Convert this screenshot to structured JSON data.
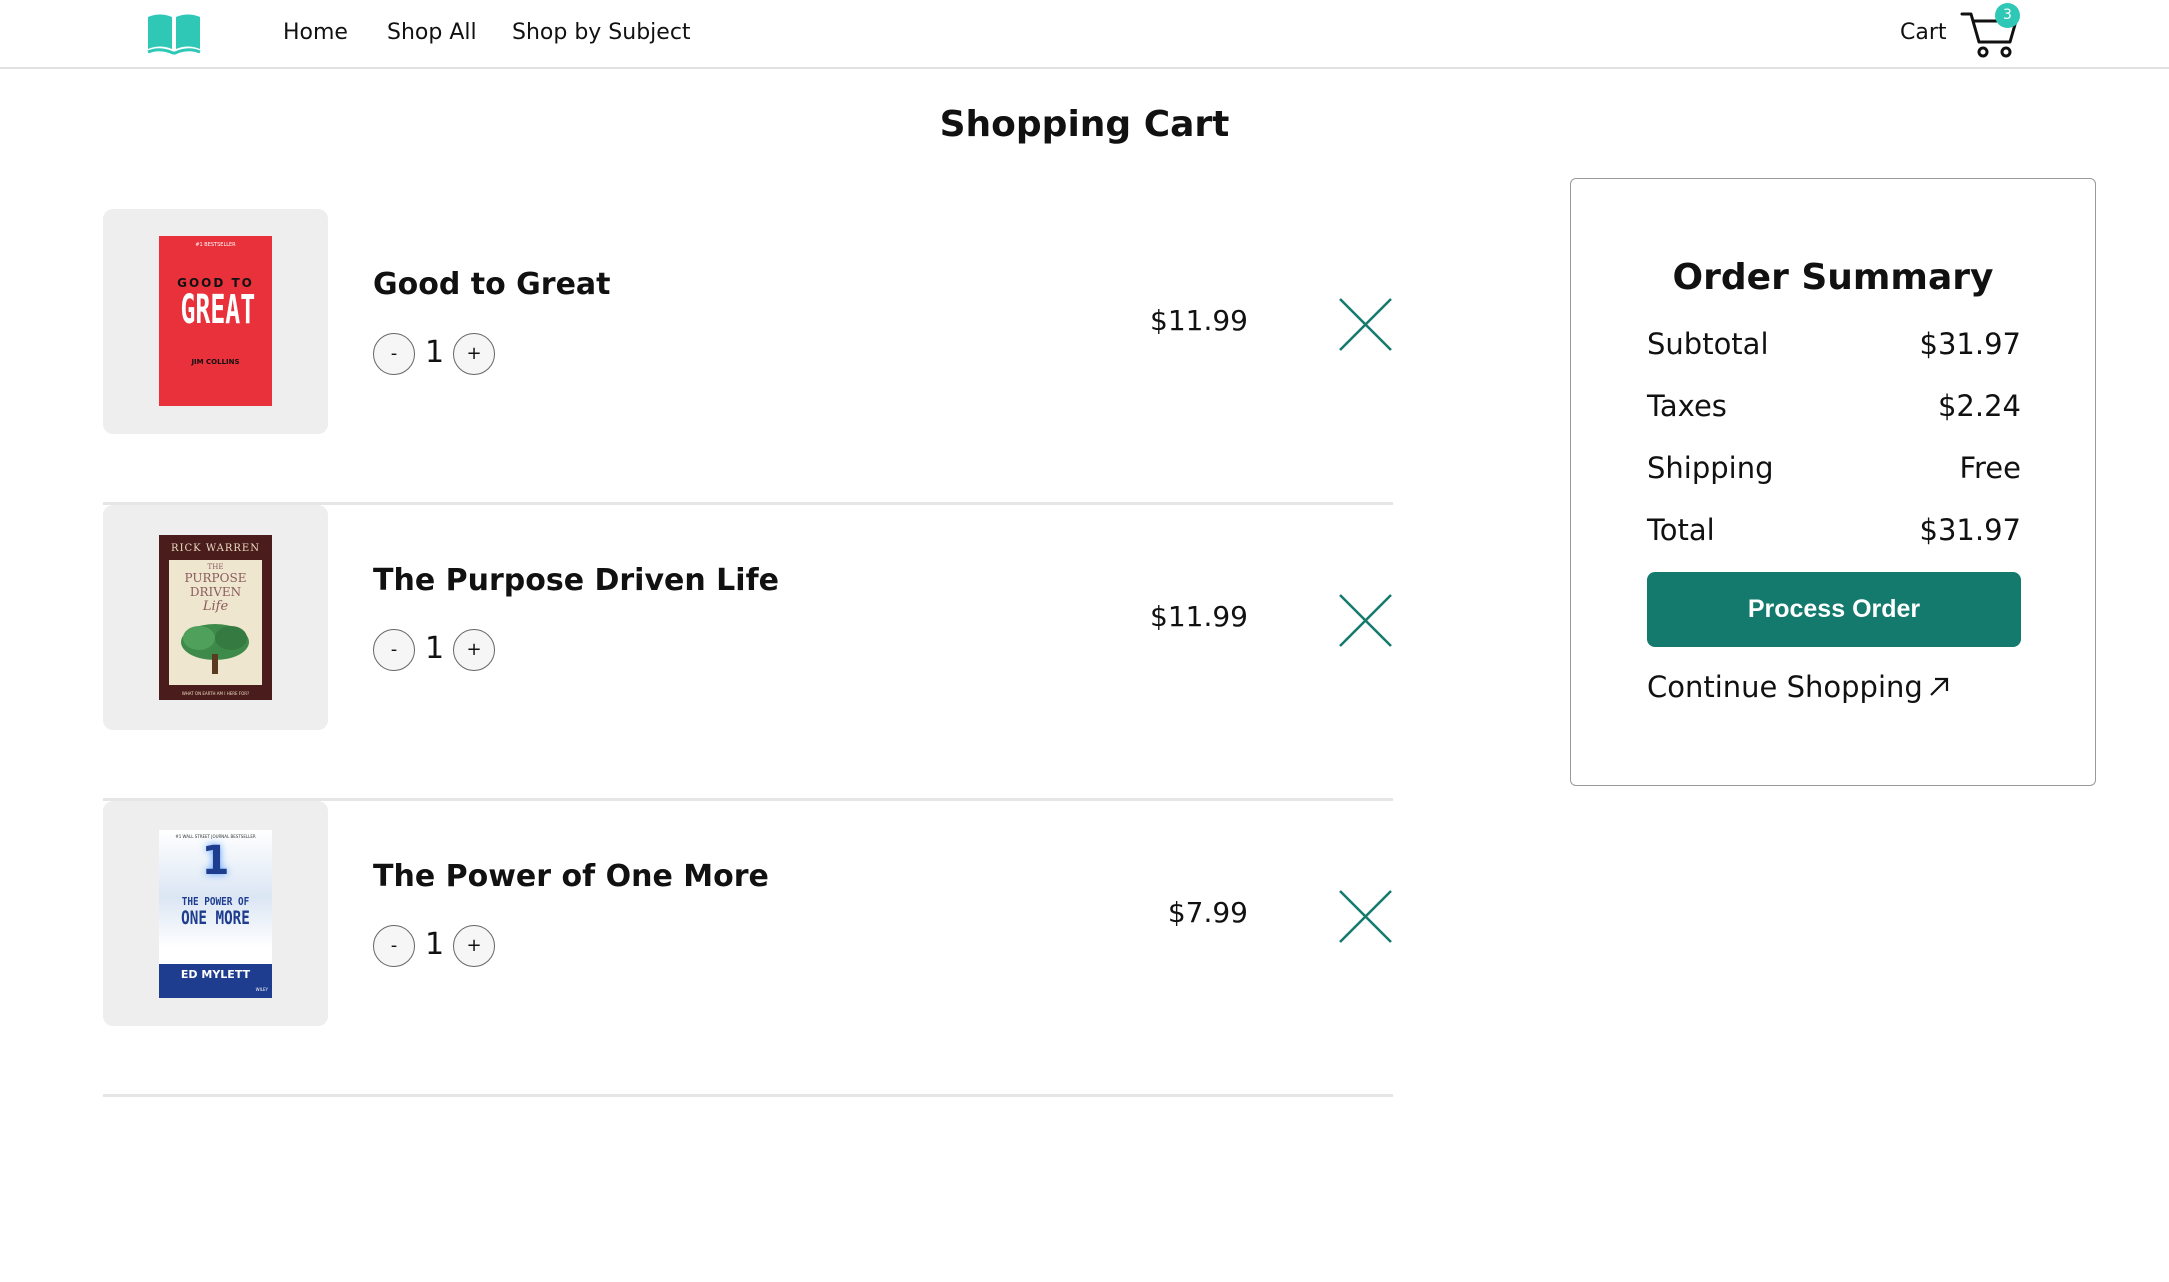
{
  "nav": {
    "links": [
      "Home",
      "Shop All",
      "Shop by Subject"
    ],
    "cart_label": "Cart",
    "cart_count": "3",
    "brand_color": "#2fc7b5"
  },
  "page": {
    "title": "Shopping Cart"
  },
  "cart_items": [
    {
      "title": "Good to Great",
      "qty": "1",
      "price": "$11.99",
      "cover": {
        "top_text": "#1 BESTSELLER",
        "line1": "GOOD TO",
        "line2": "GREAT",
        "author": "JIM COLLINS",
        "color": "#e8313a"
      }
    },
    {
      "title": "The Purpose Driven Life",
      "qty": "1",
      "price": "$11.99",
      "cover": {
        "author": "RICK WARREN",
        "line0": "THE",
        "line1": "PURPOSE",
        "line2": "DRIVEN",
        "line3": "Life",
        "footer": "WHAT ON EARTH AM I HERE FOR?",
        "color": "#4a1c1c"
      }
    },
    {
      "title": "The Power of One More",
      "qty": "1",
      "price": "$7.99",
      "cover": {
        "top_text": "#1 WALL STREET JOURNAL BESTSELLER",
        "num": "1",
        "line1": "THE POWER OF",
        "line2": "ONE MORE",
        "author": "ED MYLETT",
        "publisher": "WILEY",
        "color": "#1e3d8f"
      }
    }
  ],
  "qty_controls": {
    "minus": "-",
    "plus": "+"
  },
  "summary": {
    "title": "Order Summary",
    "rows": [
      {
        "label": "Subtotal",
        "value": "$31.97"
      },
      {
        "label": "Taxes",
        "value": "$2.24"
      },
      {
        "label": "Shipping",
        "value": "Free"
      },
      {
        "label": "Total",
        "value": "$31.97"
      }
    ],
    "process_label": "Process Order",
    "continue_label": "Continue Shopping",
    "button_color": "#137a6d"
  },
  "icons": {
    "logo": "open-book-icon",
    "cart": "shopping-cart-icon",
    "remove": "close-icon",
    "continue": "arrow-up-right-icon"
  }
}
